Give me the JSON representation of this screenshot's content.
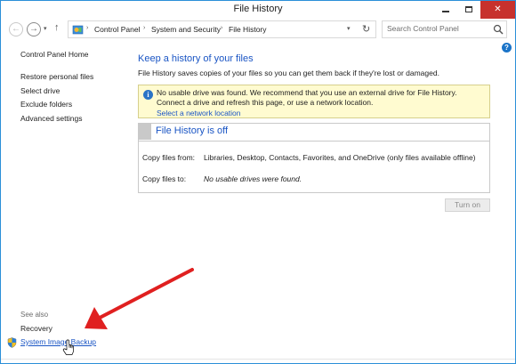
{
  "window": {
    "title": "File History",
    "min_icon": "minimize-icon",
    "max_icon": "maximize-icon",
    "close_icon": "close-icon"
  },
  "nav": {
    "back_icon": "back-arrow-icon",
    "forward_icon": "forward-arrow-icon",
    "recent_icon": "chevron-down-icon",
    "up_icon": "up-arrow-icon"
  },
  "address": {
    "crumbs": [
      "Control Panel",
      "System and Security",
      "File History"
    ],
    "refresh_icon": "refresh-icon"
  },
  "search": {
    "placeholder": "Search Control Panel",
    "value": ""
  },
  "left_nav": {
    "home": "Control Panel Home",
    "links": [
      "Restore personal files",
      "Select drive",
      "Exclude folders",
      "Advanced settings"
    ],
    "see_also": "See also",
    "see_also_links": [
      "Recovery",
      "System Image Backup"
    ]
  },
  "main": {
    "title": "Keep a history of your files",
    "description": "File History saves copies of your files so you can get them back if they're lost or damaged.",
    "warning": {
      "text": "No usable drive was found. We recommend that you use an external drive for File History. Connect a drive and refresh this page, or use a network location.",
      "link": "Select a network location"
    },
    "status_panel": {
      "title": "File History is off",
      "rows": [
        {
          "label": "Copy files from:",
          "value": "Libraries, Desktop, Contacts, Favorites, and OneDrive (only files available offline)"
        },
        {
          "label": "Copy files to:",
          "value": "No usable drives were found."
        }
      ]
    },
    "turn_on_button": "Turn on"
  },
  "colors": {
    "link_blue": "#1a55c4",
    "close_red": "#c7312d",
    "warning_bg": "#fffbd0",
    "annotation_arrow": "#e02020"
  }
}
